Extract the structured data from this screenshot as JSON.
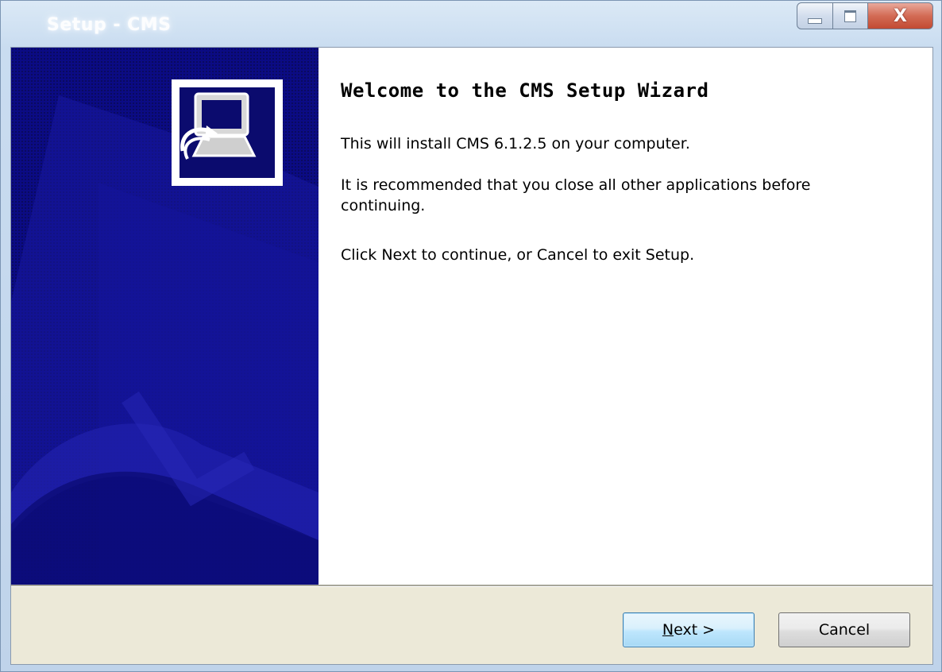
{
  "window": {
    "title": "Setup - CMS"
  },
  "controls": {
    "minimize": "minimize-icon",
    "maximize": "maximize-icon",
    "close_glyph": "X"
  },
  "wizard": {
    "heading": "Welcome to the CMS Setup Wizard",
    "install_line": "This will install CMS 6.1.2.5 on your computer.",
    "recommend_line": "It is recommended that you close all other applications before continuing.",
    "click_line": "Click Next to continue, or Cancel to exit Setup."
  },
  "buttons": {
    "next_mnemonic": "N",
    "next_rest": "ext >",
    "cancel": "Cancel"
  },
  "colors": {
    "panel_bg": "#0b0b84",
    "default_button_border": "#3c7fb1",
    "close_button": "#c24a32"
  }
}
